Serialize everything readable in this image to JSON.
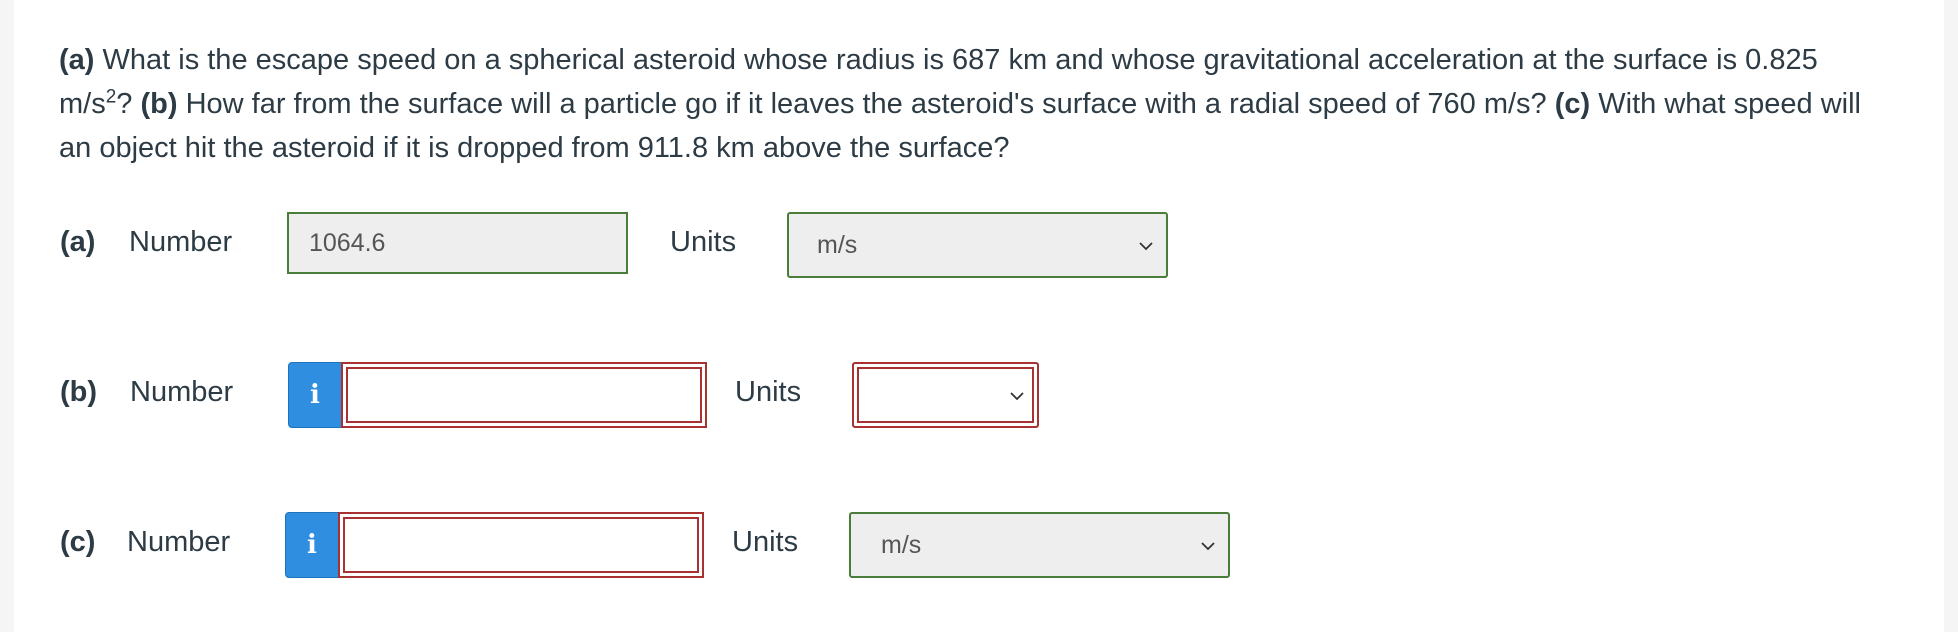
{
  "question": {
    "a_marker": "(a)",
    "a_text": " What is the escape speed on a spherical asteroid whose radius is 687 km and whose gravitational acceleration at the surface is 0.825 m/s",
    "a_sup": "2",
    "a_tail": "? ",
    "b_marker": "(b)",
    "b_text": " How far from the surface will a particle go if it leaves the asteroid's surface with a radial speed of 760 m/s? ",
    "c_marker": "(c)",
    "c_text": " With what speed will an object hit the asteroid if it is dropped from 911.8 km above the surface?"
  },
  "parts": [
    {
      "label": "(a)",
      "number_label": "Number",
      "value": "1064.6",
      "units_label": "Units",
      "units_value": "m/s",
      "status": "correct"
    },
    {
      "label": "(b)",
      "number_label": "Number",
      "value": "",
      "units_label": "Units",
      "units_value": "",
      "status": "error",
      "info_icon": "i"
    },
    {
      "label": "(c)",
      "number_label": "Number",
      "value": "",
      "units_label": "Units",
      "units_value": "m/s",
      "status": "error",
      "info_icon": "i"
    }
  ],
  "colors": {
    "correct_border": "#4a7d3a",
    "error_border": "#a83232",
    "info_button": "#2f8ee0"
  }
}
